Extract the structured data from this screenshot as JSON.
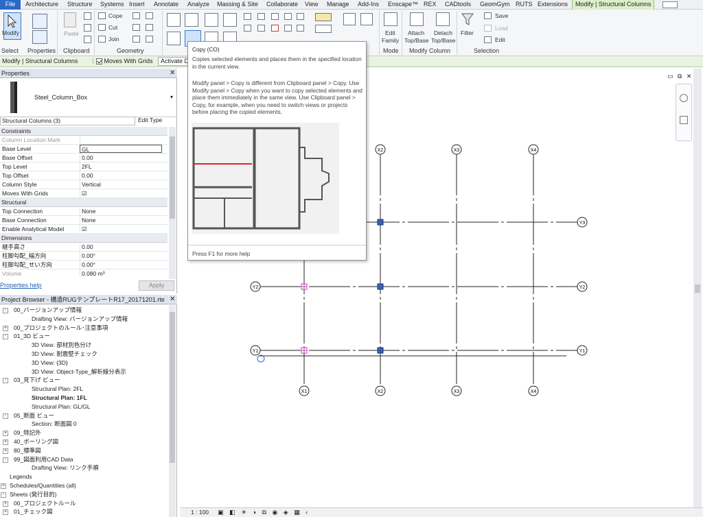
{
  "tabs": [
    "File",
    "Architecture",
    "Structure",
    "Systems",
    "Insert",
    "Annotate",
    "Analyze",
    "Massing & Site",
    "Collaborate",
    "View",
    "Manage",
    "Add-Ins",
    "Enscape™",
    "REX",
    "CADtools",
    "GeomGym",
    "RUTS",
    "Extensions",
    "Modify | Structural Columns"
  ],
  "ribbon": {
    "modify": "Modify",
    "select": "Select",
    "properties": "Properties",
    "paste": "Paste",
    "clipboard": "Clipboard",
    "cope": "Cope",
    "cut": "Cut",
    "join": "Join",
    "geometry": "Geometry",
    "edit_family_1": "Edit",
    "edit_family_2": "Family",
    "mode": "Mode",
    "attach_1": "Attach",
    "attach_2": "Top/Base",
    "detach_1": "Detach",
    "detach_2": "Top/Base",
    "modify_column": "Modify Column",
    "filter": "Filter",
    "save": "Save",
    "load": "Load",
    "edit": "Edit",
    "selection": "Selection"
  },
  "optbar": {
    "context": "Modify | Structural Columns",
    "moves_with_grids": "Moves With Grids",
    "activate": "Activate D"
  },
  "properties": {
    "title": "Properties",
    "type_name": "Steel_Column_Box",
    "selector": "Structural Columns (3)",
    "edit_type": "Edit Type",
    "groups": [
      {
        "name": "Constraints",
        "rows": [
          [
            "Column Location Mark",
            ""
          ],
          [
            "Base Level",
            "GL"
          ],
          [
            "Base Offset",
            "0.00"
          ],
          [
            "Top Level",
            "2FL"
          ],
          [
            "Top Offset",
            "0.00"
          ],
          [
            "Column Style",
            "Vertical"
          ],
          [
            "Moves With Grids",
            "☑"
          ]
        ]
      },
      {
        "name": "Structural",
        "rows": [
          [
            "Top Connection",
            "None"
          ],
          [
            "Base Connection",
            "None"
          ],
          [
            "Enable Analytical Model",
            "☑"
          ]
        ]
      },
      {
        "name": "Dimensions",
        "rows": [
          [
            "継手高さ",
            "0.00"
          ],
          [
            "柱脚勾配_幅方向",
            "0.00°"
          ],
          [
            "柱脚勾配_せい方向",
            "0.00°"
          ],
          [
            "Volume",
            "0.080 m³"
          ]
        ]
      }
    ],
    "help": "Properties help",
    "apply": "Apply"
  },
  "browser": {
    "title": "Project Browser - 構造RUGテンプレートR17_20171201.rte",
    "items": [
      {
        "t": "00_バージョンアップ情報",
        "lvl": 1,
        "tog": "-"
      },
      {
        "t": "Drafting View: バージョンアップ情報",
        "lvl": 2
      },
      {
        "t": "00_プロジェクトのルール･注意事項",
        "lvl": 1,
        "tog": "+"
      },
      {
        "t": "01_3D ビュー",
        "lvl": 1,
        "tog": "-"
      },
      {
        "t": "3D View: 部材別色分け",
        "lvl": 2
      },
      {
        "t": "3D View: 耐震壁チェック",
        "lvl": 2
      },
      {
        "t": "3D View: {3D}",
        "lvl": 2
      },
      {
        "t": "3D View: Object-Type_解析線分表示",
        "lvl": 2
      },
      {
        "t": "03_見下げ ビュー",
        "lvl": 1,
        "tog": "-"
      },
      {
        "t": "Structural Plan: 2FL",
        "lvl": 2
      },
      {
        "t": "Structural Plan: 1FL",
        "lvl": 2,
        "bold": true
      },
      {
        "t": "Structural Plan: GL/GL",
        "lvl": 2
      },
      {
        "t": "05_断面 ビュー",
        "lvl": 1,
        "tog": "-"
      },
      {
        "t": "Section: 断面図 0",
        "lvl": 2
      },
      {
        "t": "09_特記外",
        "lvl": 1,
        "tog": "+"
      },
      {
        "t": "40_ボーリング図",
        "lvl": 1,
        "tog": "+"
      },
      {
        "t": "80_標準図",
        "lvl": 1,
        "tog": "+"
      },
      {
        "t": "99_図面利用CAD Data",
        "lvl": 1,
        "tog": "-"
      },
      {
        "t": "Drafting View: リンク手順",
        "lvl": 2
      },
      {
        "t": "Legends",
        "lvl": 0
      },
      {
        "t": "Schedules/Quantities (all)",
        "lvl": 0,
        "tog": "+"
      },
      {
        "t": "Sheets (発行目的)",
        "lvl": 0,
        "tog": "-"
      },
      {
        "t": "00_プロジェクトルール",
        "lvl": 1,
        "tog": "+"
      },
      {
        "t": "01_チェック図",
        "lvl": 1,
        "tog": "+"
      }
    ]
  },
  "tooltip": {
    "title": "Copy (CO)",
    "desc": "Copies selected elements and places them in the specified location in the current view.",
    "body": "Modify panel > Copy is different from Clipboard panel > Copy. Use Modify panel > Copy when you want to copy selected elements and place them immediately in the same view. Use Clipboard panel > Copy, for example, when you need to switch views or projects before placing the copied elements.",
    "footer": "Press F1 for more help"
  },
  "grids": {
    "x": [
      "X1",
      "X2",
      "X3",
      "X4"
    ],
    "y": [
      "Y1",
      "Y2",
      "Y3"
    ]
  },
  "status": {
    "scale": "1 : 100"
  }
}
